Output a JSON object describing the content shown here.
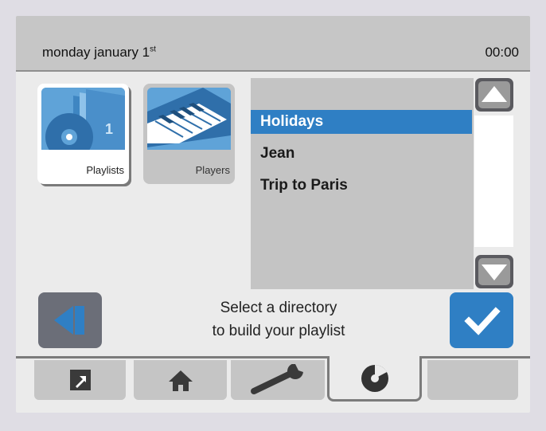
{
  "header": {
    "date_text": "monday january 1",
    "date_suffix": "st",
    "time": "00:00"
  },
  "tiles": [
    {
      "label": "Playlists",
      "selected": true,
      "icon": "discs-stack-icon"
    },
    {
      "label": "Players",
      "selected": false,
      "icon": "keyboard-icon"
    }
  ],
  "list": {
    "items": [
      {
        "label": "Holidays",
        "selected": true
      },
      {
        "label": "Jean",
        "selected": false
      },
      {
        "label": "Trip to Paris",
        "selected": false
      }
    ]
  },
  "message": {
    "line1": "Select a directory",
    "line2": "to build your playlist"
  },
  "tabs": [
    {
      "icon": "external-link-icon",
      "active": false
    },
    {
      "icon": "home-icon",
      "active": false
    },
    {
      "icon": "wrench-icon",
      "active": false
    },
    {
      "icon": "disc-icon",
      "active": true
    },
    {
      "icon": "",
      "active": false
    }
  ],
  "colors": {
    "accent": "#2f7fc4",
    "header": "#c6c6c6",
    "panel": "#c4c4c4",
    "dark_button": "#6b6e78"
  }
}
